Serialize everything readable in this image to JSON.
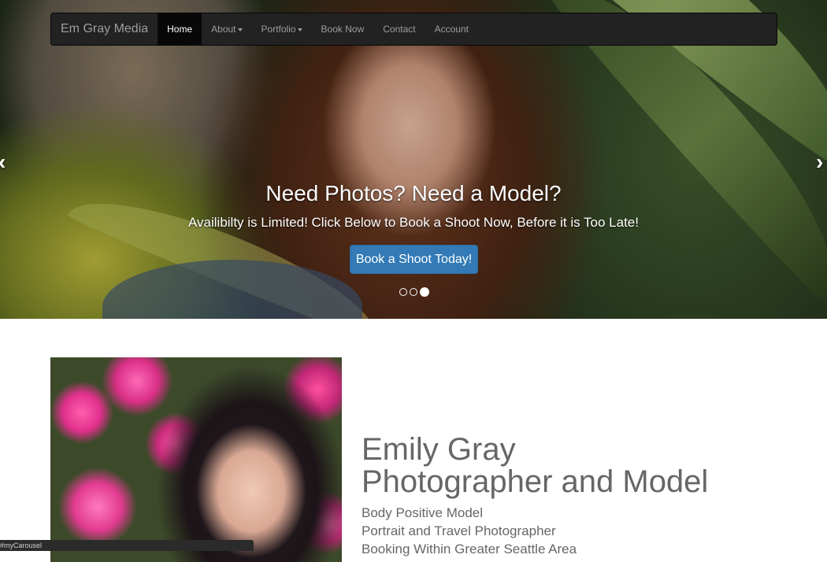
{
  "navbar": {
    "brand": "Em Gray Media",
    "items": [
      {
        "label": "Home",
        "active": true,
        "dropdown": false
      },
      {
        "label": "About",
        "active": false,
        "dropdown": true
      },
      {
        "label": "Portfolio",
        "active": false,
        "dropdown": true
      },
      {
        "label": "Book Now",
        "active": false,
        "dropdown": false
      },
      {
        "label": "Contact",
        "active": false,
        "dropdown": false
      },
      {
        "label": "Account",
        "active": false,
        "dropdown": false
      }
    ]
  },
  "carousel": {
    "title": "Need Photos? Need a Model?",
    "text": "Availibilty is Limited! Click Below to Book a Shoot Now, Before it is Too Late!",
    "button_label": "Book a Shoot Today!",
    "slide_count": 3,
    "active_slide": 3,
    "prev_icon": "chevron-left-icon",
    "next_icon": "chevron-right-icon"
  },
  "about": {
    "name": "Emily Gray",
    "role": "Photographer and Model",
    "lines": [
      "Body Positive Model",
      "Portrait and Travel Photographer",
      "Booking Within Greater Seattle Area"
    ]
  },
  "status_bar": {
    "url": "#myCarousel"
  },
  "colors": {
    "navbar_bg": "#222222",
    "navbar_active_bg": "#080808",
    "button_primary": "#337ab7",
    "text_muted": "#666666"
  }
}
